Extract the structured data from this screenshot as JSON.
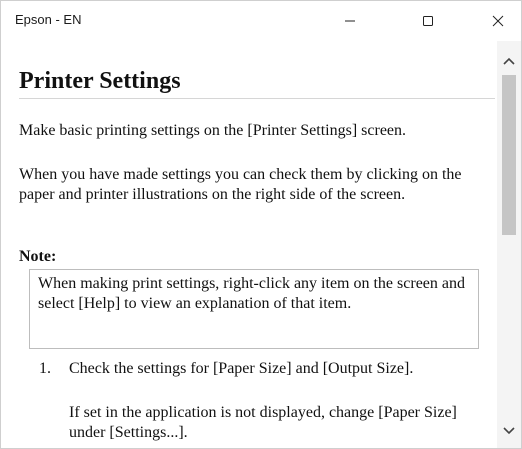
{
  "window": {
    "title": "Epson - EN"
  },
  "page": {
    "heading": "Printer Settings",
    "intro_1": "Make basic printing settings on the [Printer Settings] screen.",
    "intro_2": "When you have made settings you can check them by clicking on the paper and printer illustrations on the right side of the screen.",
    "note_label": "Note:",
    "note_text": "When making print settings, right-click any item on the screen and select [Help] to view an explanation of that item.",
    "steps": [
      {
        "number": "1.",
        "text": "Check the settings for [Paper Size] and [Output Size].",
        "subtext": "If set in the application is not displayed, change [Paper Size] under [Settings...]."
      }
    ]
  },
  "icons": {
    "minimize": "minimize-icon",
    "maximize": "maximize-icon",
    "close": "close-icon",
    "scroll_up": "chevron-up-icon",
    "scroll_down": "chevron-down-icon"
  }
}
